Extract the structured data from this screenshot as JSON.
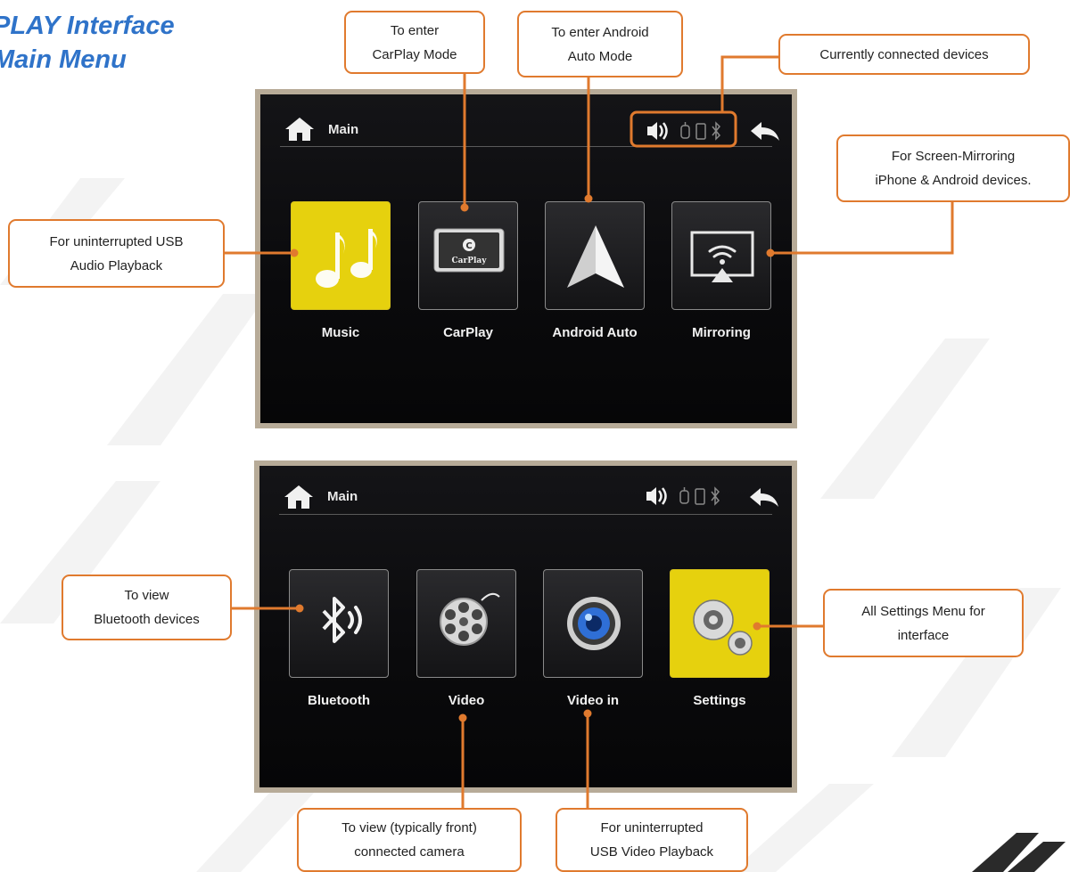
{
  "title": {
    "line1": "PLAY Interface",
    "line2": "Main Menu"
  },
  "screens": [
    {
      "header": "Main",
      "tiles": [
        {
          "label": "Music",
          "icon": "music-note-icon"
        },
        {
          "label": "CarPlay",
          "icon": "carplay-icon"
        },
        {
          "label": "Android Auto",
          "icon": "android-auto-icon"
        },
        {
          "label": "Mirroring",
          "icon": "mirroring-icon"
        }
      ]
    },
    {
      "header": "Main",
      "tiles": [
        {
          "label": "Bluetooth",
          "icon": "bluetooth-icon"
        },
        {
          "label": "Video",
          "icon": "film-reel-icon"
        },
        {
          "label": "Video in",
          "icon": "camera-lens-icon"
        },
        {
          "label": "Settings",
          "icon": "gears-icon"
        }
      ]
    }
  ],
  "callouts": {
    "carplay": "To enter\nCarPlay Mode",
    "android": "To enter Android\nAuto Mode",
    "devices": "Currently connected devices",
    "mirroring": "For Screen-Mirroring\niPhone & Android devices.",
    "music": "For uninterrupted USB\nAudio Playback",
    "bluetooth": "To view\nBluetooth devices",
    "settings": "All Settings Menu for\ninterface",
    "video": "To view (typically front)\nconnected camera",
    "videoin": "For uninterrupted\nUSB Video Playback"
  },
  "colors": {
    "accent": "#e07a2e",
    "title": "#2f73c9",
    "tile_highlight": "#e6d10e"
  }
}
